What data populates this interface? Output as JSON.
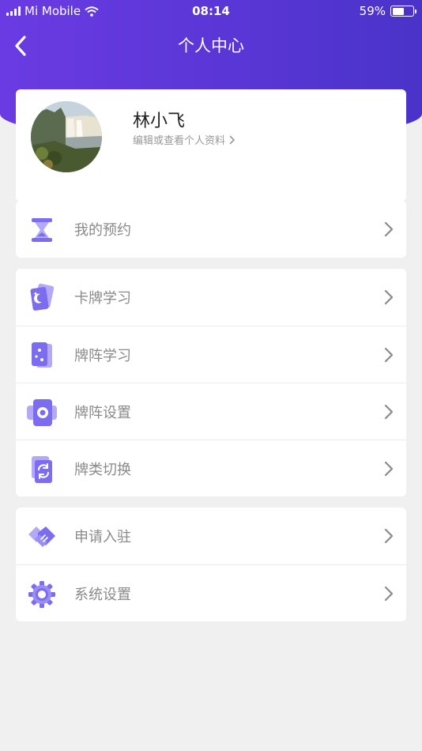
{
  "status_bar": {
    "carrier": "Mi Mobile",
    "time": "08:14",
    "battery": "59%",
    "battery_level": 0.59
  },
  "nav": {
    "title": "个人中心",
    "back_icon": "chevron-left-icon"
  },
  "profile": {
    "name": "林小飞",
    "link_label": "编辑或查看个人资料",
    "link_icon": "chevron-right-icon"
  },
  "menu": {
    "appointments": {
      "label": "我的预约",
      "icon": "hourglass-icon"
    },
    "card_study": {
      "label": "卡牌学习",
      "icon": "tarot-card-icon"
    },
    "spread_study": {
      "label": "牌阵学习",
      "icon": "spread-icon"
    },
    "spread_settings": {
      "label": "牌阵设置",
      "icon": "gear-card-icon"
    },
    "deck_switch": {
      "label": "牌类切换",
      "icon": "switch-icon"
    },
    "apply_join": {
      "label": "申请入驻",
      "icon": "handshake-icon"
    },
    "system_settings": {
      "label": "系统设置",
      "icon": "gear-icon"
    }
  },
  "colors": {
    "header_start": "#6a3be2",
    "header_end": "#4a33c9",
    "icon_primary": "#7b6cf0",
    "icon_light": "#b3a9f7",
    "label_text": "#8a8a8a",
    "background": "#f0f0f0"
  }
}
